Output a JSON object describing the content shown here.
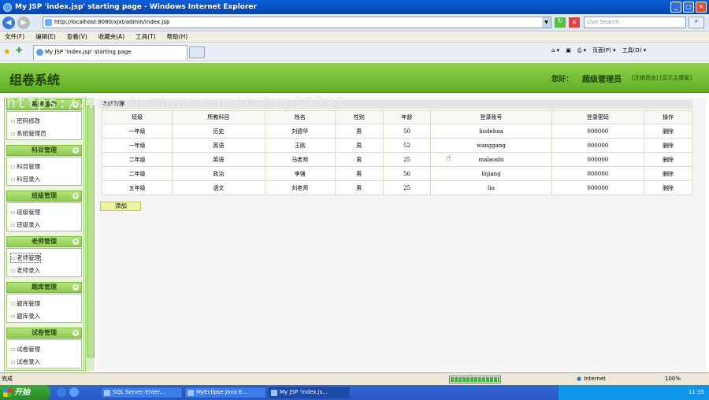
{
  "window": {
    "title": "My JSP 'index.jsp' starting page - Windows Internet Explorer"
  },
  "browser": {
    "address": "http://localhost:8080/xjxt/admin/index.jsp",
    "search_placeholder": "Live Search",
    "menu": [
      "文件(F)",
      "编辑(E)",
      "查看(V)",
      "收藏夹(A)",
      "工具(T)",
      "帮助(H)"
    ],
    "tab_title": "My JSP 'index.jsp' starting page",
    "tools": [
      "页面(P) ▾",
      "工具(O) ▾"
    ]
  },
  "header": {
    "system_title": "组卷系统",
    "greeting": "您好：",
    "user": "超级管理员",
    "links": "[注销退出] [显示主框架]"
  },
  "watermark": "https://www.huzhan.com/ishop39397",
  "sidebar": {
    "groups": [
      {
        "title": "系统操作",
        "items": [
          "密码修改",
          "系统管理员"
        ]
      },
      {
        "title": "科目管理",
        "items": [
          "科目管理",
          "科目录入"
        ]
      },
      {
        "title": "班级管理",
        "items": [
          "班级管理",
          "班级录入"
        ]
      },
      {
        "title": "老师管理",
        "items": [
          "老师管理",
          "老师录入"
        ]
      },
      {
        "title": "题库管理",
        "items": [
          "题库管理",
          "题库录入"
        ]
      },
      {
        "title": "试卷管理",
        "items": [
          "试卷管理",
          "试卷录入"
        ]
      }
    ]
  },
  "content": {
    "title": "老师管理",
    "columns": [
      "班级",
      "所教科目",
      "姓名",
      "性别",
      "年龄",
      "登录账号",
      "登录密码",
      "操作"
    ],
    "rows": [
      [
        "一年级",
        "历史",
        "刘德华",
        "男",
        "50",
        "liudehua",
        "000000",
        "删除"
      ],
      [
        "一年级",
        "英语",
        "王刚",
        "男",
        "52",
        "wanggang",
        "000000",
        "删除"
      ],
      [
        "二年级",
        "英语",
        "马老师",
        "男",
        "25",
        "malaoshi",
        "000000",
        "删除"
      ],
      [
        "二年级",
        "政治",
        "李强",
        "男",
        "56",
        "liqiang",
        "000000",
        "删除"
      ],
      [
        "五年级",
        "语文",
        "刘老师",
        "男",
        "25",
        "liu",
        "000000",
        "删除"
      ]
    ],
    "add_button": "添加"
  },
  "statusbar": {
    "left": "完成",
    "zone": "Internet",
    "zoom": "100%",
    "progress": 1.0
  },
  "taskbar": {
    "start": "开始",
    "buttons": [
      "SQL Server Enter...",
      "MyEclipse Java E...",
      "My JSP 'index.js..."
    ],
    "clock": "11:35"
  }
}
